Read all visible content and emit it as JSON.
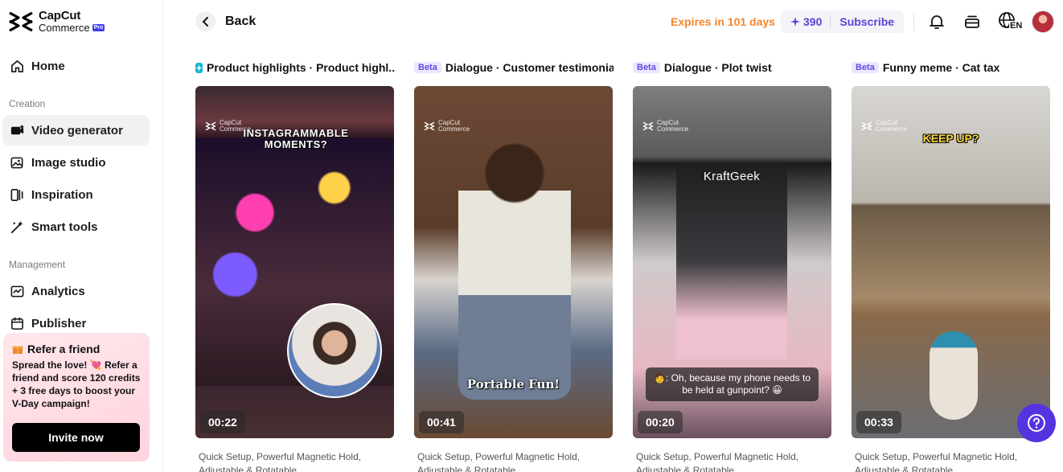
{
  "brand": {
    "name": "CapCut",
    "sub": "Commerce",
    "badge": "Pro"
  },
  "sidebar": {
    "items": [
      {
        "label": "Home",
        "icon": "home-icon"
      },
      {
        "label": "Video generator",
        "icon": "video-generator-icon"
      },
      {
        "label": "Image studio",
        "icon": "image-studio-icon"
      },
      {
        "label": "Inspiration",
        "icon": "inspiration-icon"
      },
      {
        "label": "Smart tools",
        "icon": "smart-tools-icon"
      },
      {
        "label": "Analytics",
        "icon": "analytics-icon"
      },
      {
        "label": "Publisher",
        "icon": "publisher-icon"
      }
    ],
    "sections": {
      "creation": "Creation",
      "management": "Management"
    },
    "active_item": "Video generator"
  },
  "refer": {
    "title": "Refer a friend",
    "text": "Spread the love! 💘 Refer a friend and score 120 credits + 3 free days to boost your V-Day campaign!",
    "button": "Invite now"
  },
  "header": {
    "back_label": "Back",
    "expires": "Expires in 101 days",
    "credits": "390",
    "subscribe": "Subscribe",
    "language": "EN"
  },
  "cards": [
    {
      "badge": "",
      "title": "Product highlights · Product highl...",
      "duration": "00:22",
      "caption": "INSTAGRAMMABLE MOMENTS?",
      "desc": "Quick Setup, Powerful Magnetic Hold, Adjustable & Rotatable"
    },
    {
      "badge": "Beta",
      "title": "Dialogue · Customer testimonial",
      "duration": "00:41",
      "caption": "Portable Fun!",
      "desc": "Quick Setup, Powerful Magnetic Hold, Adjustable & Rotatable"
    },
    {
      "badge": "Beta",
      "title": "Dialogue · Plot twist",
      "duration": "00:20",
      "caption": "🧑: Oh, because my phone needs to be held at gunpoint? 😀",
      "overlay_text": "KraftGeek",
      "desc": "Quick Setup, Powerful Magnetic Hold, Adjustable & Rotatable"
    },
    {
      "badge": "Beta",
      "title": "Funny meme · Cat tax",
      "duration": "00:33",
      "caption": "KEEP UP?",
      "desc": "Quick Setup, Powerful Magnetic Hold, Adjustable & Rotatable"
    }
  ],
  "watermark": {
    "line1": "CapCut",
    "line2": "Commerce"
  },
  "colors": {
    "accent": "#5a43d6",
    "expires": "#f5862a",
    "help": "#5533e0"
  }
}
